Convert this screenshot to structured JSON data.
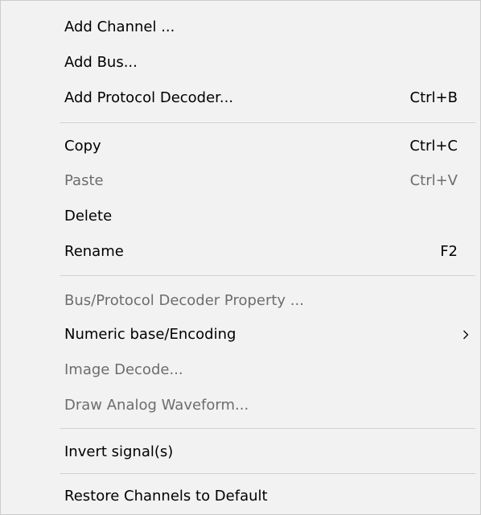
{
  "menu": {
    "add_channel": {
      "label": "Add Channel ..."
    },
    "add_bus": {
      "label": "Add Bus..."
    },
    "add_protocol_decoder": {
      "label": "Add Protocol Decoder...",
      "shortcut": "Ctrl+B"
    },
    "copy": {
      "label": "Copy",
      "shortcut": "Ctrl+C"
    },
    "paste": {
      "label": "Paste",
      "shortcut": "Ctrl+V",
      "disabled": true
    },
    "delete": {
      "label": "Delete"
    },
    "rename": {
      "label": "Rename",
      "shortcut": "F2"
    },
    "bus_protocol_property": {
      "label": "Bus/Protocol Decoder Property ...",
      "disabled": true
    },
    "numeric_base": {
      "label": "Numeric base/Encoding",
      "submenu_icon": "chevron-right-icon"
    },
    "image_decode": {
      "label": "Image Decode...",
      "disabled": true
    },
    "draw_analog": {
      "label": "Draw Analog Waveform...",
      "disabled": true
    },
    "invert_signal": {
      "label": "Invert signal(s)"
    },
    "restore_channels": {
      "label": "Restore Channels to Default"
    }
  },
  "colors": {
    "menu_background": "#f2f2f2",
    "menu_border": "#cccccc",
    "text_enabled": "#000000",
    "text_disabled": "#6d6d6d",
    "separator": "#d2d2d2"
  }
}
